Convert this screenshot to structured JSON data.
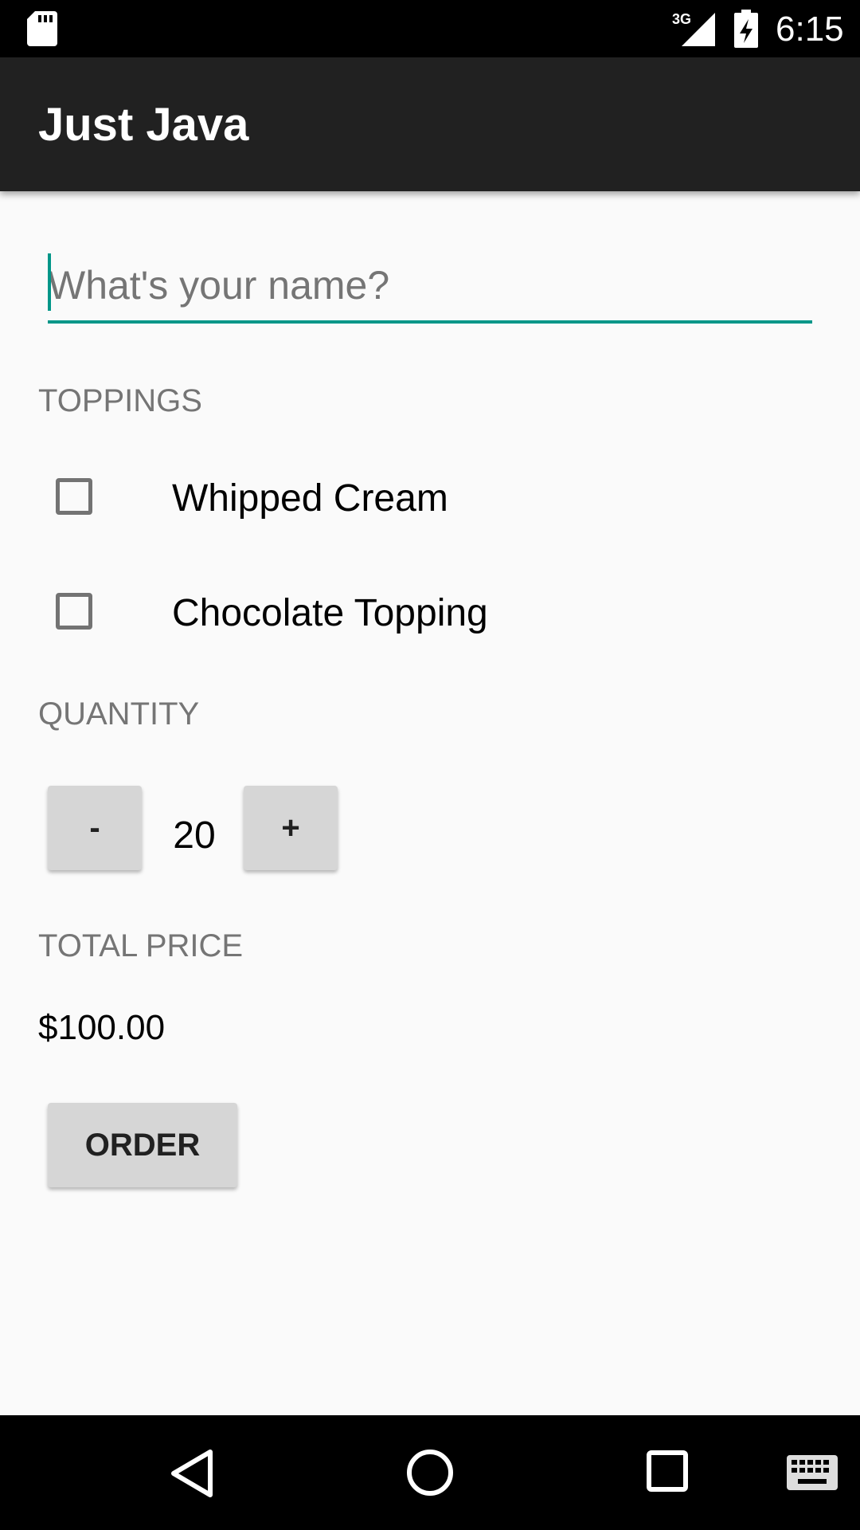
{
  "status_bar": {
    "network_type": "3G",
    "time": "6:15",
    "icons": [
      "sd-card-icon",
      "signal-icon",
      "battery-charging-icon"
    ]
  },
  "app_bar": {
    "title": "Just Java"
  },
  "name_field": {
    "placeholder": "What's your name?",
    "value": ""
  },
  "toppings": {
    "header": "TOPPINGS",
    "options": [
      {
        "label": "Whipped Cream",
        "checked": false
      },
      {
        "label": "Chocolate Topping",
        "checked": false
      }
    ]
  },
  "quantity": {
    "header": "QUANTITY",
    "decrement_label": "-",
    "value": "20",
    "increment_label": "+"
  },
  "total": {
    "header": "TOTAL PRICE",
    "value": "$100.00"
  },
  "order_button": {
    "label": "ORDER"
  },
  "nav_bar": {
    "icons": [
      "back-icon",
      "home-icon",
      "recents-icon",
      "keyboard-icon"
    ]
  },
  "colors": {
    "accent": "#009688",
    "app_bar": "#212121",
    "background": "#fafafa",
    "button": "#d6d6d6",
    "secondary_text": "#757575"
  }
}
